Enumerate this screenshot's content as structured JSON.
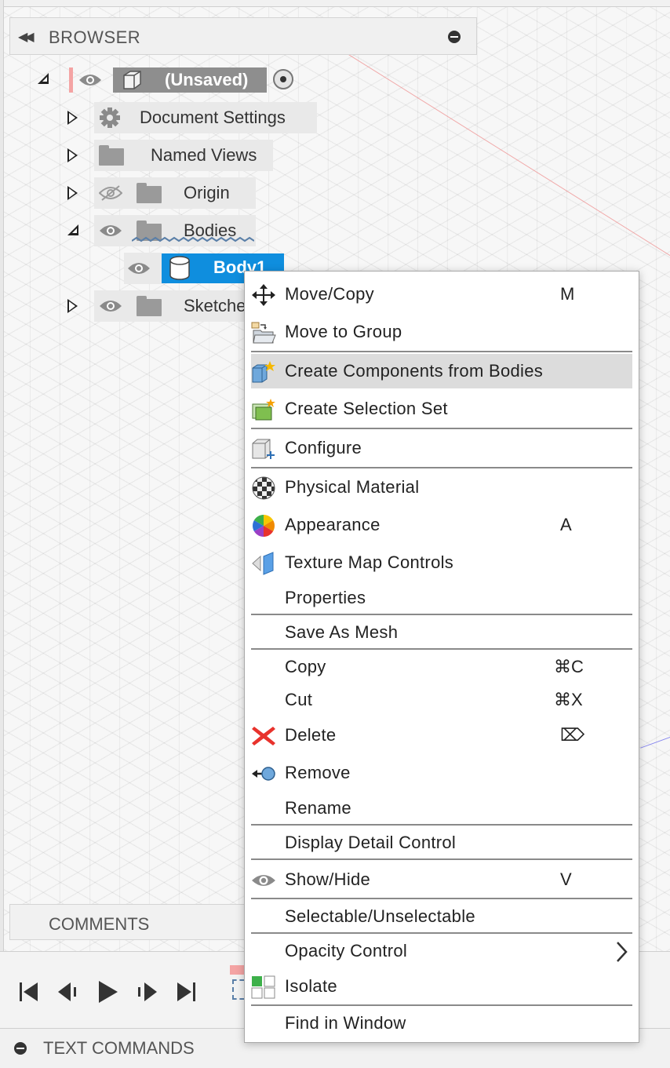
{
  "browser": {
    "title": "BROWSER",
    "root_label": "(Unsaved)",
    "items": [
      {
        "label": "Document Settings"
      },
      {
        "label": "Named Views"
      },
      {
        "label": "Origin"
      },
      {
        "label": "Bodies"
      },
      {
        "label": "Body1"
      },
      {
        "label": "Sketche"
      }
    ]
  },
  "comments": {
    "label": "COMMENTS"
  },
  "text_commands": {
    "label": "TEXT COMMANDS"
  },
  "context_menu": {
    "items": [
      {
        "label": "Move/Copy",
        "shortcut": "M"
      },
      {
        "label": "Move to Group",
        "shortcut": ""
      },
      {
        "label": "Create Components from Bodies",
        "shortcut": ""
      },
      {
        "label": "Create Selection Set",
        "shortcut": ""
      },
      {
        "label": "Configure",
        "shortcut": ""
      },
      {
        "label": "Physical Material",
        "shortcut": ""
      },
      {
        "label": "Appearance",
        "shortcut": "A"
      },
      {
        "label": "Texture Map Controls",
        "shortcut": ""
      },
      {
        "label": "Properties",
        "shortcut": ""
      },
      {
        "label": "Save As Mesh",
        "shortcut": ""
      },
      {
        "label": "Copy",
        "shortcut": "⌘C"
      },
      {
        "label": "Cut",
        "shortcut": "⌘X"
      },
      {
        "label": "Delete",
        "shortcut": "⌦"
      },
      {
        "label": "Remove",
        "shortcut": ""
      },
      {
        "label": "Rename",
        "shortcut": ""
      },
      {
        "label": "Display Detail Control",
        "shortcut": ""
      },
      {
        "label": "Show/Hide",
        "shortcut": "V"
      },
      {
        "label": "Selectable/Unselectable",
        "shortcut": ""
      },
      {
        "label": "Opacity Control",
        "shortcut": ""
      },
      {
        "label": "Isolate",
        "shortcut": ""
      },
      {
        "label": "Find in Window",
        "shortcut": ""
      }
    ]
  },
  "colors": {
    "selection_blue": "#0f8ede",
    "highlight_gray": "#dcdcdc",
    "delete_red": "#e8322c"
  }
}
